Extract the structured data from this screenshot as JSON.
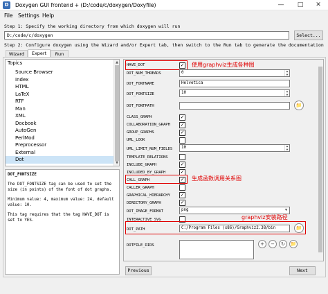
{
  "window": {
    "title": "Doxygen GUI frontend + (D:/code/c/doxygen/Doxyfile)"
  },
  "menu": [
    "File",
    "Settings",
    "Help"
  ],
  "step1": {
    "label": "Step 1: Specify the working directory from which doxygen will run",
    "path": "D:/code/c/doxygen",
    "select_label": "Select..."
  },
  "step2": {
    "label": "Step 2: Configure doxygen using the Wizard and/or Expert tab, then switch to the Run tab to generate the documentation"
  },
  "tabs": [
    "Wizard",
    "Expert",
    "Run"
  ],
  "topics": {
    "header": "Topics",
    "items": [
      "Source Browser",
      "Index",
      "HTML",
      "LaTeX",
      "RTF",
      "Man",
      "XML",
      "Docbook",
      "AutoGen",
      "PerlMod",
      "Preprocessor",
      "External",
      "Dot"
    ]
  },
  "help": {
    "title": "DOT_FONTSIZE",
    "p1": "The DOT_FONTSIZE tag can be used to set the size (in points) of the font of dot graphs.",
    "p2": "Minimum value: 4, maximum value: 24, default value: 10.",
    "p3": "This tag requires that the tag HAVE_DOT is set to YES."
  },
  "options": {
    "have_dot": "HAVE_DOT",
    "dot_num_threads": "DOT_NUM_THREADS",
    "dot_num_threads_value": "0",
    "dot_fontname": "DOT_FONTNAME",
    "dot_fontname_value": "Helvetica",
    "dot_fontsize": "DOT_FONTSIZE",
    "dot_fontsize_value": "10",
    "dot_fontpath": "DOT_FONTPATH",
    "class_graph": "CLASS_GRAPH",
    "collaboration_graph": "COLLABORATION_GRAPH",
    "group_graphs": "GROUP_GRAPHS",
    "uml_look": "UML_LOOK",
    "uml_limit_num_fields": "UML_LIMIT_NUM_FIELDS",
    "uml_limit_num_fields_value": "10",
    "template_relations": "TEMPLATE_RELATIONS",
    "include_graph": "INCLUDE_GRAPH",
    "included_by_graph": "INCLUDED_BY_GRAPH",
    "call_graph": "CALL_GRAPH",
    "caller_graph": "CALLER_GRAPH",
    "graphical_hierarchy": "GRAPHICAL_HIERARCHY",
    "directory_graph": "DIRECTORY_GRAPH",
    "dot_image_format": "DOT_IMAGE_FORMAT",
    "dot_image_format_value": "png",
    "interactive_svg": "INTERACTIVE_SVG",
    "dot_path": "DOT_PATH",
    "dot_path_value": "C:/Program Files (x86)/Graphviz2.38/bin",
    "dotfile_dirs": "DOTFILE_DIRS"
  },
  "annotations": {
    "have_dot": "使用graphviz生成各种图",
    "call_graph": "生成函数调用关系图",
    "dot_path": "graphviz安装路径",
    "color": "#e00000"
  },
  "buttons": {
    "previous": "Previous",
    "next": "Next"
  }
}
